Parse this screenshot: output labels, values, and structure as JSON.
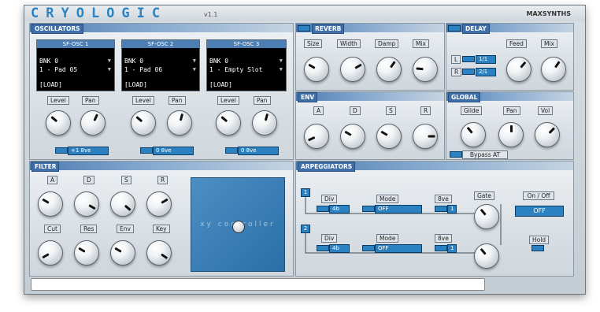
{
  "app": {
    "logo": "CRYOLOGIC",
    "version": "v1.1",
    "maker": "MAXSYNTHS"
  },
  "oscillators": {
    "title": "OSCILLATORS",
    "units": [
      {
        "header": "SF-OSC 1",
        "bank": "BNK  0",
        "patch": "1 - Pad 05",
        "load": "[LOAD]",
        "level_label": "Level",
        "pan_label": "Pan",
        "octave": "+1 8ve"
      },
      {
        "header": "SF-OSC 2",
        "bank": "BNK  0",
        "patch": "1 - Pad 06",
        "load": "[LOAD]",
        "level_label": "Level",
        "pan_label": "Pan",
        "octave": "0   8ve"
      },
      {
        "header": "SF-OSC 3",
        "bank": "BNK  0",
        "patch": "1 - Empty Slot",
        "load": "[LOAD]",
        "level_label": "Level",
        "pan_label": "Pan",
        "octave": "0   8ve"
      }
    ]
  },
  "reverb": {
    "title": "REVERB",
    "labels": [
      "Size",
      "Width",
      "Damp",
      "Mix"
    ]
  },
  "delay": {
    "title": "DELAY",
    "feed_label": "Feed",
    "mix_label": "Mix",
    "l_label": "L",
    "l_value": "1/1",
    "r_label": "R",
    "r_value": "2/1"
  },
  "env": {
    "title": "ENV",
    "labels": [
      "A",
      "D",
      "S",
      "R"
    ]
  },
  "global": {
    "title": "GLOBAL",
    "labels": [
      "Glide",
      "Pan",
      "Vol"
    ],
    "bypass": "Bypass AT"
  },
  "filter": {
    "title": "FILTER",
    "row1": [
      "A",
      "D",
      "S",
      "R"
    ],
    "row2": [
      "Cut",
      "Res",
      "Env",
      "Key"
    ],
    "xy_label": "xy controller"
  },
  "arpeggiators": {
    "title": "ARPEGGIATORS",
    "arp1": {
      "num": "1",
      "div_label": "Div",
      "div_value": "4b",
      "mode_label": "Mode",
      "mode_value": "OFF",
      "oct_label": "8ve",
      "oct_value": "1"
    },
    "arp2": {
      "num": "2",
      "div_label": "Div",
      "div_value": "4b",
      "mode_label": "Mode",
      "mode_value": "OFF",
      "oct_label": "8ve",
      "oct_value": "1"
    },
    "gate_label": "Gate",
    "onoff_label": "On / Off",
    "onoff_value": "OFF",
    "hold_label": "Hold"
  },
  "colors": {
    "accent": "#2c82c0",
    "panel_header": "#4d7bb0"
  }
}
